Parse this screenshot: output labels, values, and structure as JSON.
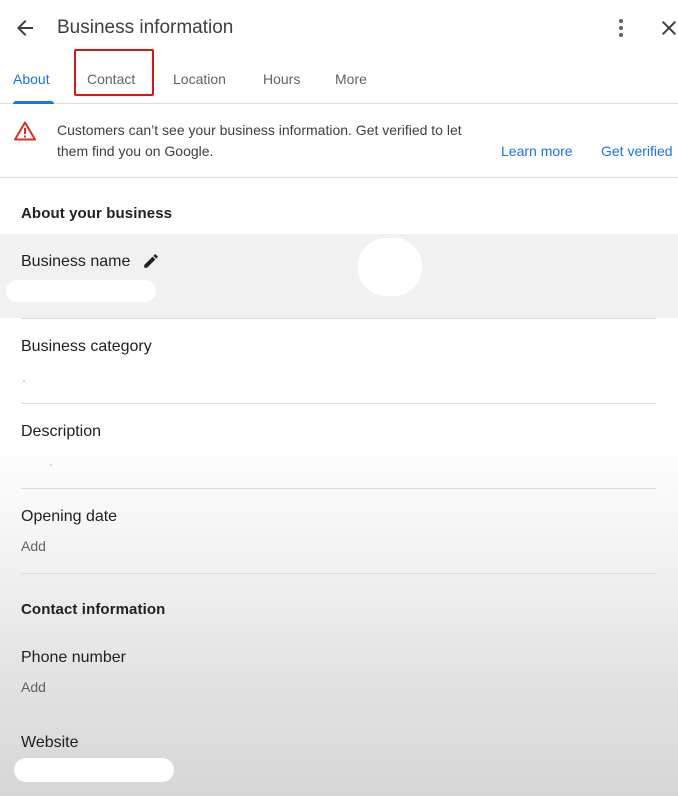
{
  "header": {
    "title": "Business information",
    "back_icon": "arrow-left-icon",
    "more_icon": "more-vertical-icon",
    "close_icon": "close-icon"
  },
  "tabs": [
    {
      "label": "About",
      "active": true
    },
    {
      "label": "Contact",
      "active": false,
      "highlighted": true
    },
    {
      "label": "Location",
      "active": false
    },
    {
      "label": "Hours",
      "active": false
    },
    {
      "label": "More",
      "active": false
    }
  ],
  "alert": {
    "icon": "warning-icon",
    "text": "Customers can’t see your business information. Get verified to let them find you on Google.",
    "learn_more": "Learn more",
    "get_verified": "Get verified"
  },
  "about_section": {
    "heading": "About your business",
    "business_name_label": "Business name",
    "edit_icon": "pencil-icon",
    "business_category_label": "Business category",
    "description_label": "Description",
    "opening_date_label": "Opening date",
    "opening_date_value": "Add"
  },
  "contact_section": {
    "heading": "Contact information",
    "phone_label": "Phone number",
    "phone_value": "Add",
    "website_label": "Website"
  },
  "colors": {
    "accent": "#1a73e8",
    "warning": "#d93025",
    "highlight_box": "#d01818",
    "divider": "#dadce0"
  }
}
